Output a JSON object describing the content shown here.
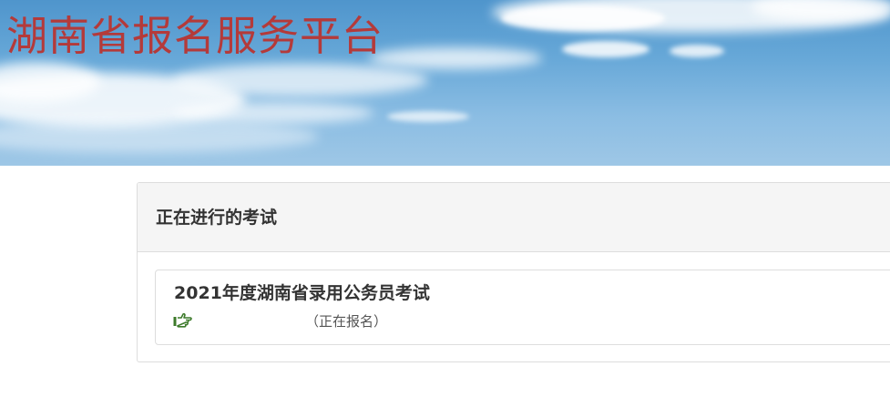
{
  "header": {
    "site_title": "湖南省报名服务平台"
  },
  "exams_panel": {
    "heading": "正在进行的考试",
    "items": [
      {
        "title": "2021年度湖南省录用公务员考试",
        "link_icon": "pointing-hand-icon",
        "status": "（正在报名）"
      }
    ]
  },
  "colors": {
    "title_red": "#b43a3a",
    "icon_green": "#3c7a2a",
    "sky_blue": "#67a8d8"
  }
}
